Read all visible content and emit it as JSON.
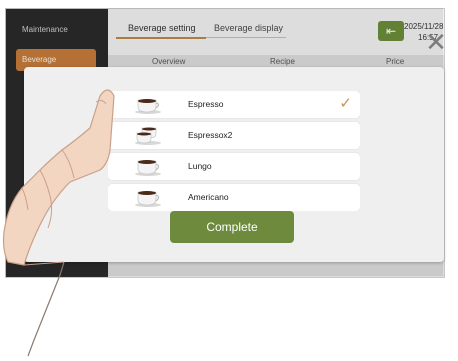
{
  "sidebar": {
    "items": [
      {
        "label": "Maintenance"
      },
      {
        "label": "Beverage"
      }
    ]
  },
  "tabs": [
    {
      "label": "Beverage setting"
    },
    {
      "label": "Beverage display"
    }
  ],
  "subheaders": [
    "Overview",
    "Recipe",
    "Price"
  ],
  "datetime": {
    "date": "2025/11/28",
    "time": "16:57"
  },
  "icons": {
    "exit": "exit-icon",
    "close": "close-icon",
    "check": "checkmark-icon",
    "cup": "coffee-cup-icon"
  },
  "beverages": [
    {
      "name": "Espresso",
      "selected": true
    },
    {
      "name": "Espressox2",
      "selected": false
    },
    {
      "name": "Lungo",
      "selected": false
    },
    {
      "name": "Americano",
      "selected": false
    }
  ],
  "complete_label": "Complete",
  "colors": {
    "accent_green": "#6e8a3d",
    "accent_orange": "#c47a3a",
    "check": "#c8954a"
  }
}
